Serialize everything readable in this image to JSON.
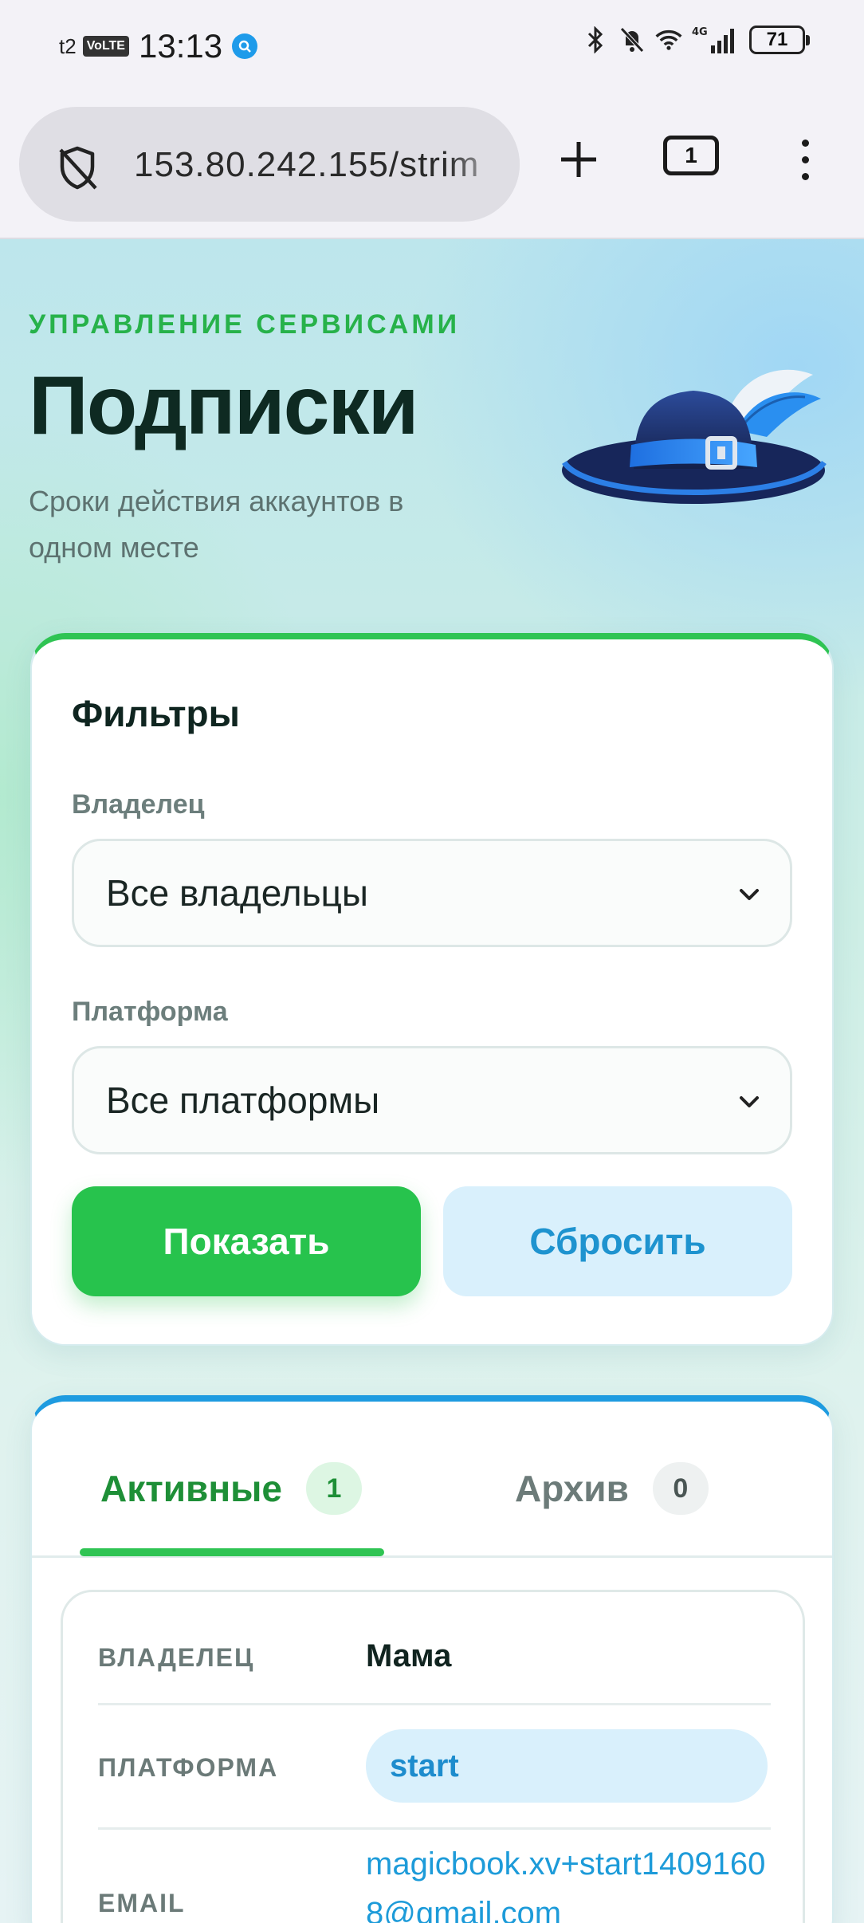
{
  "status_bar": {
    "carrier": "t2",
    "volte": "VoLTE",
    "time": "13:13",
    "network": "4G",
    "battery": "71",
    "icons": [
      "bluetooth-icon",
      "bell-off-icon",
      "wifi-icon",
      "signal-icon"
    ]
  },
  "browser": {
    "url": "153.80.242.155/strim",
    "tab_count": "1",
    "icons": [
      "shield-off-icon",
      "plus-icon",
      "tabs-icon",
      "menu-icon"
    ]
  },
  "header": {
    "eyebrow": "УПРАВЛЕНИЕ СЕРВИСАМИ",
    "title": "Подписки",
    "subtitle": "Сроки действия аккаунтов в одном месте"
  },
  "filters": {
    "title": "Фильтры",
    "owner_label": "Владелец",
    "owner_value": "Все владельцы",
    "platform_label": "Платформа",
    "platform_value": "Все платформы",
    "show_button": "Показать",
    "reset_button": "Сбросить"
  },
  "tabs": [
    {
      "label": "Активные",
      "count": "1"
    },
    {
      "label": "Архив",
      "count": "0"
    }
  ],
  "subscription": {
    "owner_key": "ВЛАДЕЛЕЦ",
    "owner_value": "Мама",
    "platform_key": "ПЛАТФОРМА",
    "platform_value": "start",
    "email_key": "EMAIL",
    "email_value": "magicbook.xv+start14091608@gmail.com"
  },
  "colors": {
    "accent_green": "#27c34d",
    "accent_blue": "#1e9be0",
    "title_dark": "#0e2a22"
  }
}
